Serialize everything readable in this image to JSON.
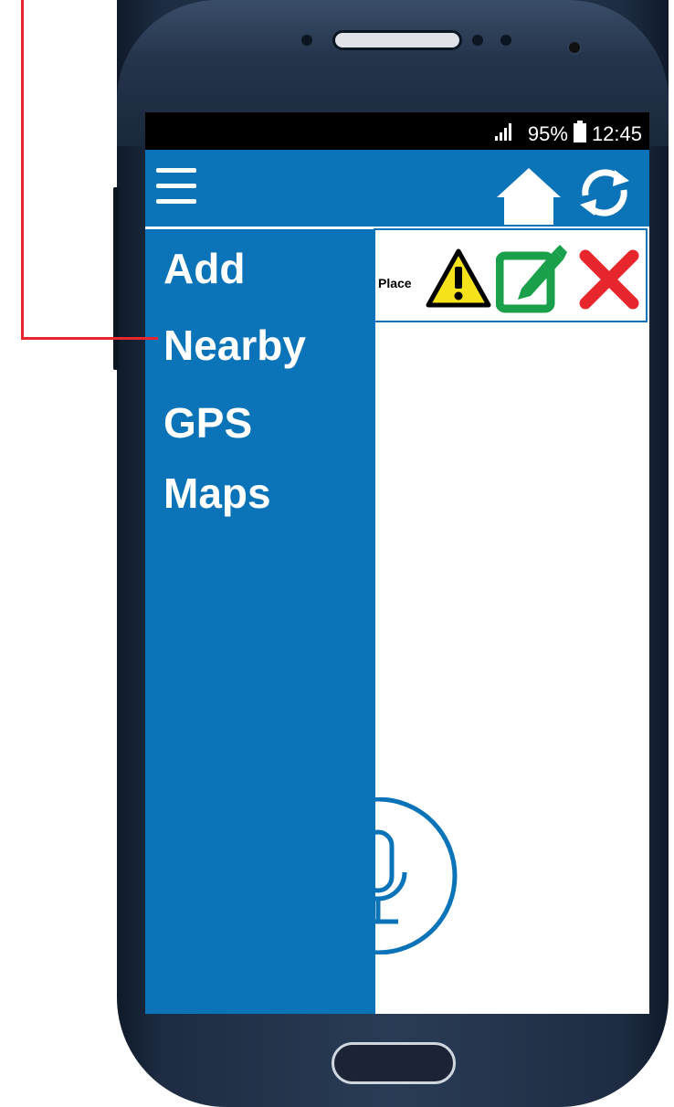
{
  "status_bar": {
    "battery": "95%",
    "time": "12:45",
    "icons": [
      "signal-icon",
      "battery-icon"
    ]
  },
  "app_bar": {
    "icons": [
      "hamburger-menu-icon",
      "home-icon",
      "refresh-icon"
    ]
  },
  "card": {
    "place_label": "Place",
    "icons": [
      "warning-icon",
      "edit-icon",
      "delete-icon"
    ]
  },
  "drawer": {
    "items": [
      {
        "label": "Add"
      },
      {
        "label": "Nearby"
      },
      {
        "label": "GPS"
      },
      {
        "label": "Maps"
      }
    ]
  },
  "mic": {
    "icon": "microphone-icon"
  },
  "colors": {
    "primary": "#0b73b8",
    "callout": "#e8262d",
    "warning": "#f5e21b",
    "edit": "#1aa04a",
    "delete": "#e8262d"
  }
}
